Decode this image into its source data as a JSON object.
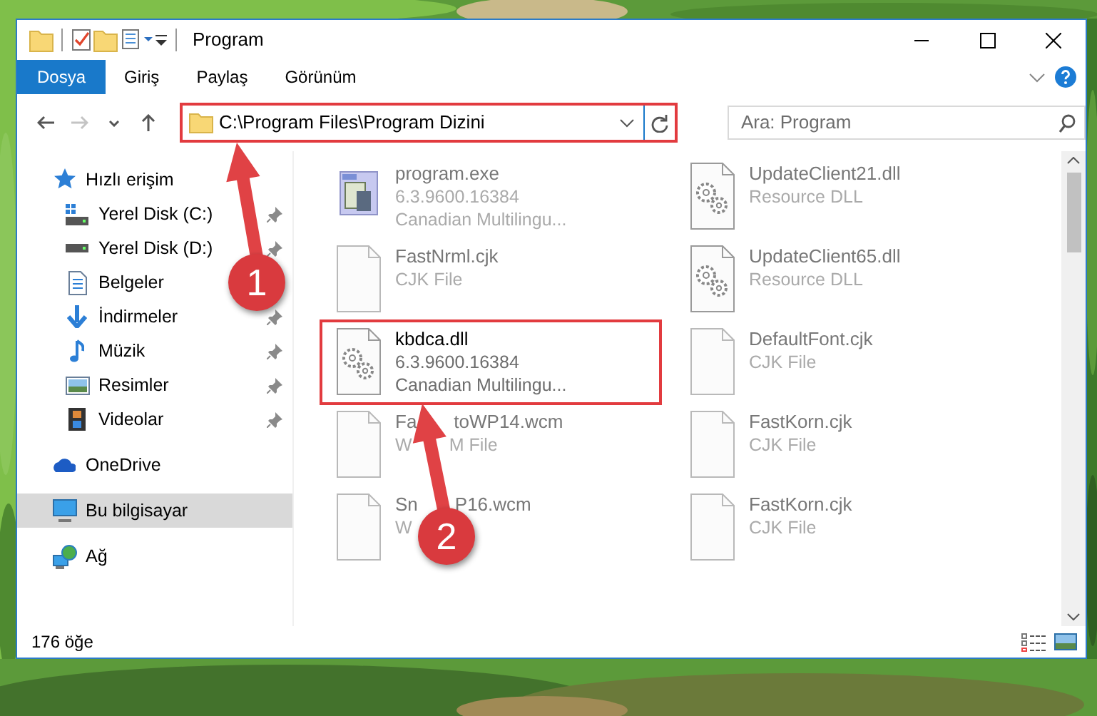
{
  "window": {
    "title": "Program"
  },
  "ribbon_tabs": [
    {
      "label": "Dosya",
      "selected": true
    },
    {
      "label": "Giriş",
      "selected": false
    },
    {
      "label": "Paylaş",
      "selected": false
    },
    {
      "label": "Görünüm",
      "selected": false
    }
  ],
  "nav_buttons": [
    {
      "kind": "back",
      "disabled": false
    },
    {
      "kind": "forward",
      "disabled": true
    },
    {
      "kind": "recent",
      "disabled": false
    },
    {
      "kind": "up",
      "disabled": false
    }
  ],
  "address": {
    "path": "C:\\Program Files\\Program Dizini",
    "highlighted": true
  },
  "search": {
    "placeholder": "Ara: Program"
  },
  "sidebar": {
    "items": [
      {
        "label": "Hızlı erişim",
        "kind": "quick",
        "selected": false,
        "children": [
          {
            "label": "Yerel Disk (C:)",
            "kind": "system_drive",
            "pinned": true,
            "selected": false
          },
          {
            "label": "Yerel Disk (D:)",
            "kind": "drive",
            "pinned": true,
            "selected": false
          },
          {
            "label": "Belgeler",
            "kind": "documents",
            "selected": false
          },
          {
            "label": "İndirmeler",
            "kind": "downloads",
            "pinned": true,
            "selected": false
          },
          {
            "label": "Müzik",
            "kind": "music",
            "pinned": true,
            "selected": false
          },
          {
            "label": "Resimler",
            "kind": "pictures",
            "pinned": true,
            "selected": false
          },
          {
            "label": "Videolar",
            "kind": "videos",
            "pinned": true,
            "selected": false
          }
        ]
      },
      {
        "label": "OneDrive",
        "kind": "cloud",
        "selected": false
      },
      {
        "label": "Bu bilgisayar",
        "kind": "computer",
        "selected": true
      },
      {
        "label": "Ağ",
        "kind": "network",
        "selected": false
      }
    ]
  },
  "files": [
    {
      "name": [
        "program.exe"
      ],
      "details": [
        [
          "6.3.9600.16384"
        ],
        [
          "Canadian Multilingu..."
        ]
      ],
      "kind": "exe",
      "blurred": true,
      "highlighted": false
    },
    {
      "name": [
        "UpdateClient21.dll"
      ],
      "details": [
        [
          "Resource DLL"
        ]
      ],
      "kind": "dll",
      "blurred": true,
      "highlighted": false
    },
    {
      "name": [
        "FastNrml.cjk"
      ],
      "details": [
        [
          "CJK File"
        ]
      ],
      "kind": "file",
      "blurred": true,
      "highlighted": false
    },
    {
      "name": [
        "UpdateClient65.dll"
      ],
      "details": [
        [
          "Resource DLL"
        ]
      ],
      "kind": "dll",
      "blurred": true,
      "highlighted": false
    },
    {
      "name": [
        "kbdca.dll"
      ],
      "details": [
        [
          "6.3.9600.16384"
        ],
        [
          "Canadian Multilingu..."
        ]
      ],
      "kind": "dll",
      "blurred": false,
      "highlighted": true
    },
    {
      "name": [
        "DefaultFont.cjk"
      ],
      "details": [
        [
          "CJK File"
        ]
      ],
      "kind": "file",
      "blurred": true,
      "highlighted": false
    },
    {
      "name": [
        "Fa",
        "toWP14.wcm"
      ],
      "details": [
        [
          "W",
          "M File"
        ]
      ],
      "kind": "file",
      "blurred": true,
      "highlighted": false
    },
    {
      "name": [
        "FastKorn.cjk"
      ],
      "details": [
        [
          "CJK File"
        ]
      ],
      "kind": "file",
      "blurred": true,
      "highlighted": false
    },
    {
      "name": [
        "Sn",
        "P16.wcm"
      ],
      "details": [
        [
          "W"
        ]
      ],
      "kind": "file",
      "blurred": true,
      "highlighted": false
    },
    {
      "name": [
        "FastKorn.cjk"
      ],
      "details": [
        [
          "CJK File"
        ]
      ],
      "kind": "file",
      "blurred": true,
      "highlighted": false
    }
  ],
  "status_bar": {
    "item_count": "176 öğe"
  },
  "annotations": [
    {
      "number": "1"
    },
    {
      "number": "2"
    }
  ]
}
